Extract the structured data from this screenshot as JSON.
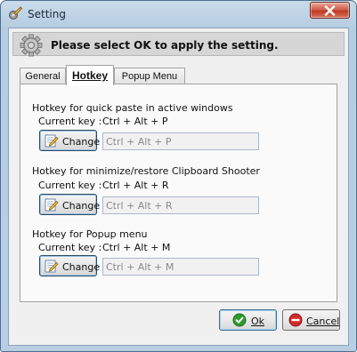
{
  "window": {
    "title": "Setting",
    "icon": "settings-pencil-icon",
    "close_icon": "close-icon"
  },
  "header": {
    "icon": "gear-icon",
    "message": "Please select OK to apply the setting."
  },
  "tabs": [
    {
      "label": "General",
      "active": false
    },
    {
      "label": "Hotkey",
      "active": true
    },
    {
      "label": "Popup Menu",
      "active": false
    }
  ],
  "hotkeys": [
    {
      "title": "Hotkey for quick paste in active windows",
      "current_label": "Current key :",
      "current_value": "Ctrl + Alt + P",
      "button_label": "Change",
      "input_value": "Ctrl + Alt + P"
    },
    {
      "title": "Hotkey for minimize/restore Clipboard Shooter",
      "current_label": "Current key :",
      "current_value": "Ctrl + Alt + R",
      "button_label": "Change",
      "input_value": "Ctrl + Alt + R"
    },
    {
      "title": "Hotkey for Popup menu",
      "current_label": "Current key :",
      "current_value": "Ctrl + Alt + M",
      "button_label": "Change",
      "input_value": "Ctrl + Alt + M"
    }
  ],
  "footer": {
    "ok_label": "Ok",
    "cancel_label": "Cancel"
  },
  "colors": {
    "accent": "#3b6f9c",
    "close_red": "#c03a25",
    "ok_green": "#2e9b2e",
    "cancel_red": "#d32a2a"
  }
}
